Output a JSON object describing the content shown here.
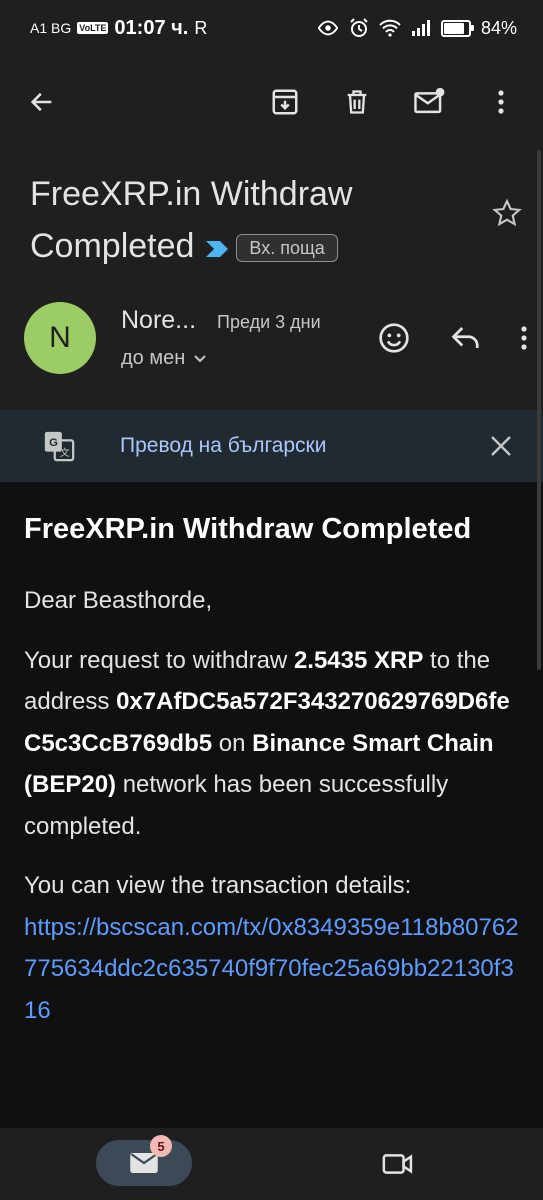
{
  "status_bar": {
    "carrier": "A1 BG",
    "volte": "VoLTE",
    "time": "01:07 ч.",
    "r": "R",
    "battery": "84%",
    "battery_level": 0.84
  },
  "toolbar": {
    "back": "back-arrow-icon",
    "archive": "archive-icon",
    "delete": "trash-icon",
    "mark_unread": "mail-unread-icon",
    "more": "more-vert-icon"
  },
  "email": {
    "subject": "FreeXRP.in Withdraw Completed",
    "label": "Вх. поща",
    "sender_initial": "N",
    "sender_name": "Nore...",
    "time": "Преди 3 дни",
    "to": "до мен"
  },
  "translate": {
    "label": "Превод на български"
  },
  "body": {
    "heading": "FreeXRP.in Withdraw Completed",
    "greeting": "Dear Beasthorde,",
    "p1_pre": "Your request to withdraw ",
    "amount": "2.5435 XRP",
    "p1_mid": " to the address ",
    "address": "0x7AfDC5a572F343270629769D6feC5c3CcB769db5",
    "p1_on": " on ",
    "network": "Binance Smart Chain (BEP20)",
    "p1_post": " network has been successfully completed.",
    "p2": "You can view the transaction details:",
    "link": "https://bscscan.com/tx/0x8349359e118b80762775634ddc2c635740f9f70fec25a69bb22130f316"
  },
  "bottom_nav": {
    "mail_badge": "5"
  },
  "colors": {
    "background": "#1f1f1f",
    "body_background": "#101010",
    "link": "#5e9bff",
    "avatar": "#9ccc65",
    "translate_bar": "#212a31",
    "badge": "#f2b8b5"
  }
}
